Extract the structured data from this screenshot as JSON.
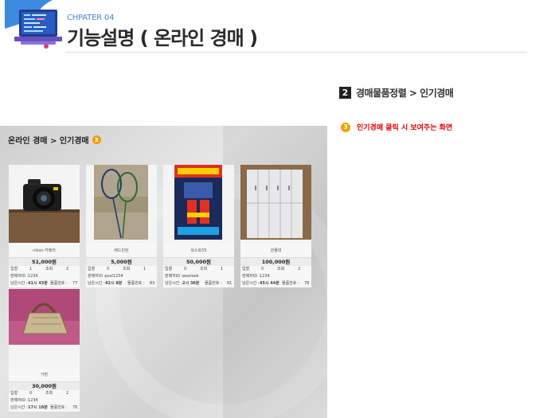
{
  "header": {
    "chapter": "CHPATER 04",
    "title": "기능설명 ( 온라인 경매 )"
  },
  "section": {
    "number": "2",
    "label": "경매물품정렬 > 인기경매"
  },
  "note": {
    "badge": "3",
    "text": "인기경매 클릭 시 보여주는 화면"
  },
  "panel": {
    "title": "온라인 경매 > 인기경매",
    "badge": "3"
  },
  "labels": {
    "bid": "입찰",
    "views": "조회",
    "seller": "판매자ID :",
    "remaining": "남은시간 :",
    "item_no": "물품번호 :"
  },
  "items": [
    {
      "name": "nikon 카메라",
      "price": "51,000원",
      "bids": "1",
      "views": "2",
      "seller": "1234",
      "time": "41시 43분",
      "item_no": "77"
    },
    {
      "name": "배드민턴",
      "price": "5,000원",
      "bids": "0",
      "views": "1",
      "seller": "pssl1234",
      "time": "42시 8분",
      "item_no": "83"
    },
    {
      "name": "워스토55",
      "price": "50,000원",
      "bids": "0",
      "views": "1",
      "seller": "woolook",
      "time": "2시 36분",
      "item_no": "81"
    },
    {
      "name": "관물대",
      "price": "100,000원",
      "bids": "0",
      "views": "2",
      "seller": "1234",
      "time": "45시 44분",
      "item_no": "78"
    },
    {
      "name": "가방",
      "price": "30,000원",
      "bids": "0",
      "views": "2",
      "seller": "1234",
      "time": "17시 18분",
      "item_no": "76"
    }
  ],
  "colors": {
    "chapter": "#4a86d8",
    "note": "#e00000",
    "badge": "#f0a000"
  }
}
